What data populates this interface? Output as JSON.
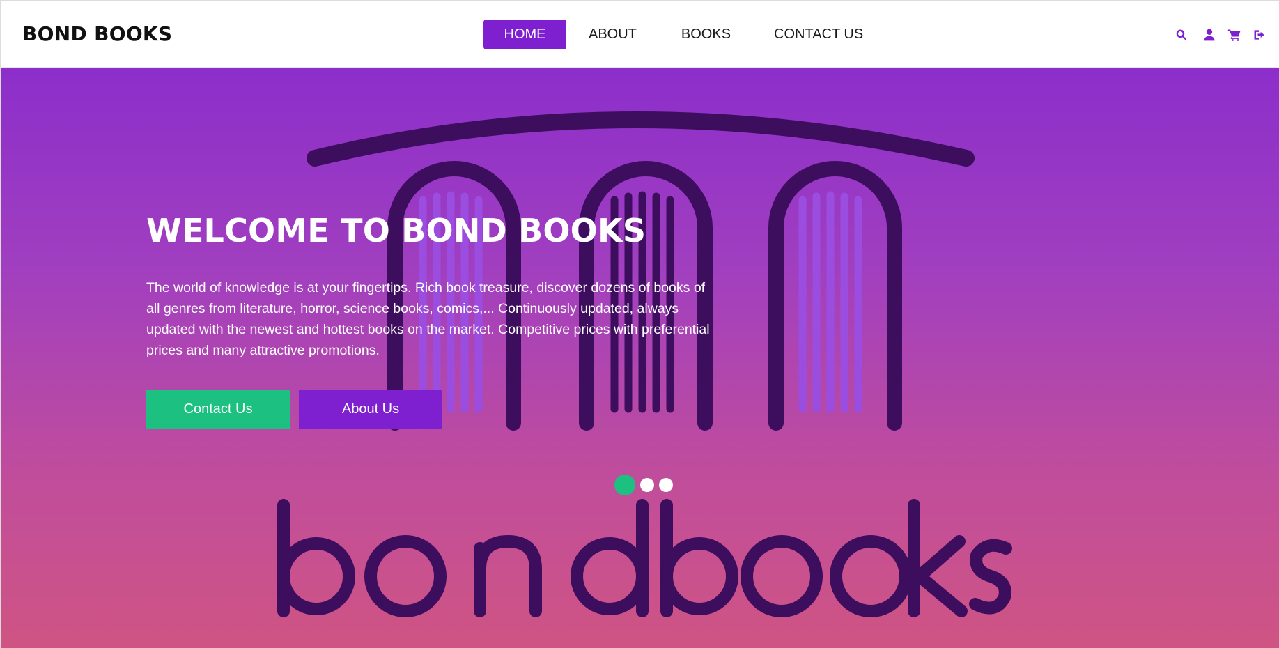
{
  "brand": "BOND BOOKS",
  "nav": {
    "home": "HOME",
    "about": "ABOUT",
    "books": "BOOKS",
    "contact": "CONTACT US"
  },
  "icons": [
    "search-icon",
    "user-icon",
    "cart-icon",
    "sign-out-icon"
  ],
  "hero": {
    "title": "WELCOME TO BOND BOOKS",
    "text": "The world of knowledge is at your fingertips. Rich book treasure, discover dozens of books of all genres from literature, horror, science books, comics,... Continuously updated, always updated with the newest and hottest books on the market. Competitive prices with preferential prices and many attractive promotions.",
    "contact_button": "Contact Us",
    "about_button": "About Us",
    "background_logo_text": "bond books"
  },
  "carousel": {
    "slides": 3,
    "active_slide": 1
  },
  "colors": {
    "accent": "#7e1fd0",
    "green": "#1cc080",
    "logo_dark": "#3d0d5e"
  }
}
